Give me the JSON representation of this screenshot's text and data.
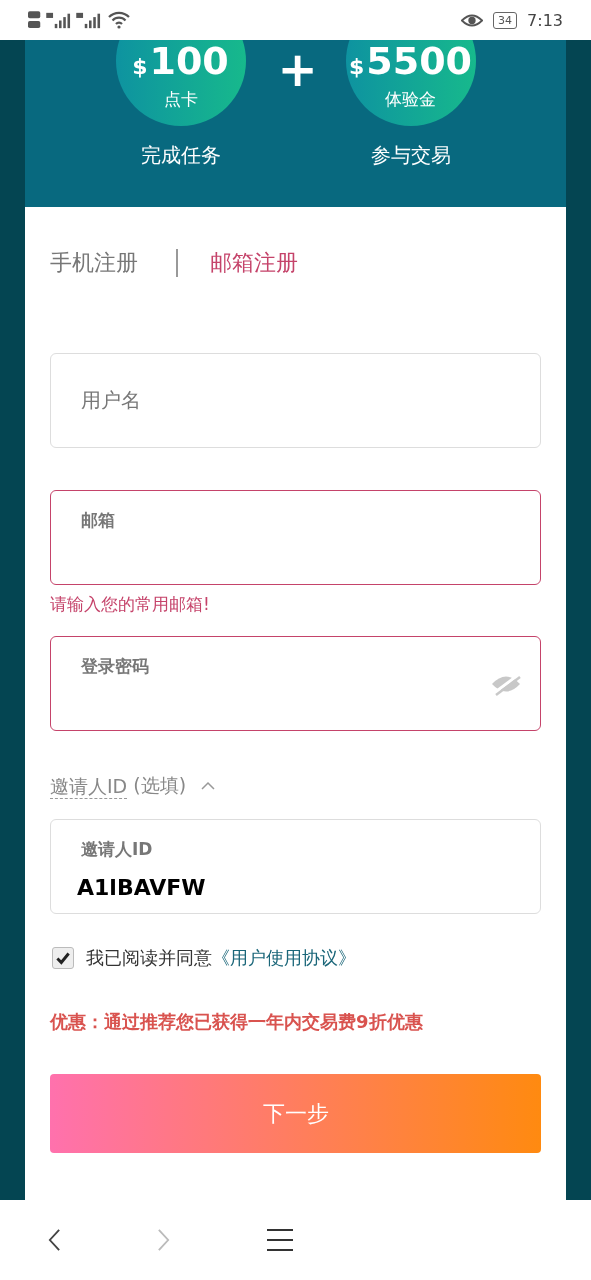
{
  "status_bar": {
    "battery": "34",
    "time": "7:13"
  },
  "banner": {
    "plus": "+",
    "rewards": [
      {
        "currency": "$",
        "amount": "100",
        "unit": "点卡",
        "caption": "完成任务"
      },
      {
        "currency": "$",
        "amount": "5500",
        "unit": "体验金",
        "caption": "参与交易"
      }
    ]
  },
  "tabs": [
    {
      "label": "手机注册",
      "selected": false
    },
    {
      "label": "邮箱注册",
      "selected": true
    }
  ],
  "fields": [
    {
      "label": "用户名",
      "floating": false,
      "invalid": false
    },
    {
      "label": "邮箱",
      "floating": true,
      "invalid": true,
      "error": "请输入您的常用邮箱!"
    },
    {
      "label": "登录密码",
      "floating": true,
      "invalid": true,
      "visibility_toggle": true
    }
  ],
  "invite": {
    "toggle": {
      "label": "邀请人ID",
      "hint": "(选填)",
      "expanded": true
    },
    "field": {
      "label": "邀请人ID",
      "value": "A1lBAVFW"
    }
  },
  "agreement": {
    "checked": true,
    "text": "我已阅读并同意",
    "link": "《用户使用协议》"
  },
  "promo": "优惠：通过推荐您已获得一年内交易费9折优惠",
  "next_button": "下一步",
  "browser_bar": {
    "forward_disabled": true
  }
}
